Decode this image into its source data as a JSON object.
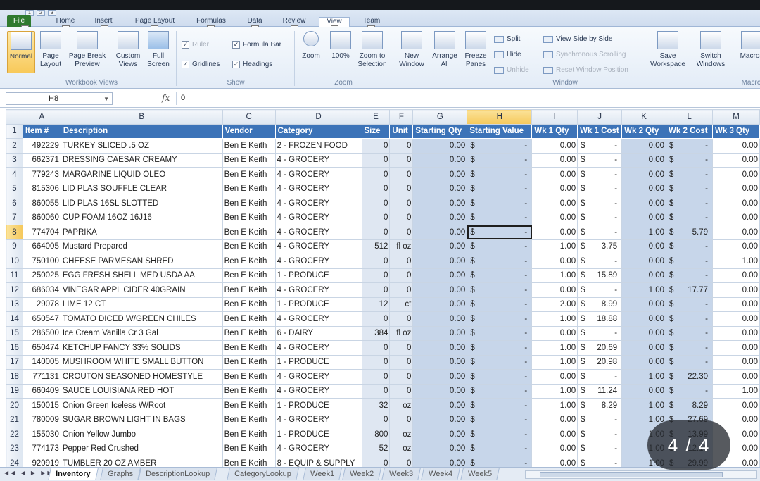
{
  "ribbon": {
    "file_tab": "File",
    "tabs": [
      "Home",
      "Insert",
      "Page Layout",
      "Formulas",
      "Data",
      "Review",
      "View",
      "Team"
    ],
    "active_tab": "View",
    "keytips": [
      "H",
      "N",
      "P",
      "M",
      "A",
      "R",
      "W",
      "Y"
    ],
    "file_keytip": "F",
    "qat_keytips": [
      "1",
      "2",
      "3"
    ],
    "workbook_views": {
      "title": "Workbook Views",
      "normal": "Normal",
      "page_layout": "Page Layout",
      "page_break_preview": "Page Break Preview",
      "custom_views": "Custom Views",
      "full_screen": "Full Screen"
    },
    "show": {
      "title": "Show",
      "ruler": "Ruler",
      "formula_bar": "Formula Bar",
      "gridlines": "Gridlines",
      "headings": "Headings"
    },
    "zoom": {
      "title": "Zoom",
      "zoom": "Zoom",
      "hundred": "100%",
      "zoom_to_selection": "Zoom to Selection"
    },
    "window": {
      "title": "Window",
      "new_window": "New Window",
      "arrange_all": "Arrange All",
      "freeze_panes": "Freeze Panes",
      "split": "Split",
      "hide": "Hide",
      "unhide": "Unhide",
      "view_side_by_side": "View Side by Side",
      "synchronous_scrolling": "Synchronous Scrolling",
      "reset_window_position": "Reset Window Position",
      "save_workspace": "Save Workspace",
      "switch_windows": "Switch Windows",
      "macros": "Macros"
    },
    "macros_group_title": "Macros"
  },
  "formula_bar": {
    "name_box": "H8",
    "fx": "fx",
    "value": "0"
  },
  "columns": [
    "A",
    "B",
    "C",
    "D",
    "E",
    "F",
    "G",
    "H",
    "I",
    "J",
    "K",
    "L",
    "M"
  ],
  "selected_column": "H",
  "selected_row": "8",
  "headers": [
    "Item #",
    "Description",
    "Vendor",
    "Category",
    "Size",
    "Unit",
    "Starting Qty",
    "Starting Value",
    "Wk 1 Qty",
    "Wk 1 Cost",
    "Wk 2 Qty",
    "Wk 2 Cost",
    "Wk 3 Qty"
  ],
  "rows": [
    {
      "r": "2",
      "item": "492229",
      "desc": "TURKEY SLICED .5 OZ",
      "vendor": "Ben E Keith",
      "cat": "2 - FROZEN FOOD",
      "size": "0",
      "unit": "0",
      "sqty": "0.00",
      "sval": "-",
      "w1q": "0.00",
      "w1c": "-",
      "w2q": "0.00",
      "w2c": "-",
      "w3q": "0.00"
    },
    {
      "r": "3",
      "item": "662371",
      "desc": "DRESSING CAESAR CREAMY",
      "vendor": "Ben E Keith",
      "cat": "4 - GROCERY",
      "size": "0",
      "unit": "0",
      "sqty": "0.00",
      "sval": "-",
      "w1q": "0.00",
      "w1c": "-",
      "w2q": "0.00",
      "w2c": "-",
      "w3q": "0.00"
    },
    {
      "r": "4",
      "item": "779243",
      "desc": "MARGARINE LIQUID OLEO",
      "vendor": "Ben E Keith",
      "cat": "4 - GROCERY",
      "size": "0",
      "unit": "0",
      "sqty": "0.00",
      "sval": "-",
      "w1q": "0.00",
      "w1c": "-",
      "w2q": "0.00",
      "w2c": "-",
      "w3q": "0.00"
    },
    {
      "r": "5",
      "item": "815306",
      "desc": "LID PLAS SOUFFLE CLEAR",
      "vendor": "Ben E Keith",
      "cat": "4 - GROCERY",
      "size": "0",
      "unit": "0",
      "sqty": "0.00",
      "sval": "-",
      "w1q": "0.00",
      "w1c": "-",
      "w2q": "0.00",
      "w2c": "-",
      "w3q": "0.00"
    },
    {
      "r": "6",
      "item": "860055",
      "desc": "LID PLAS 16SL SLOTTED",
      "vendor": "Ben E Keith",
      "cat": "4 - GROCERY",
      "size": "0",
      "unit": "0",
      "sqty": "0.00",
      "sval": "-",
      "w1q": "0.00",
      "w1c": "-",
      "w2q": "0.00",
      "w2c": "-",
      "w3q": "0.00"
    },
    {
      "r": "7",
      "item": "860060",
      "desc": "CUP FOAM 16OZ 16J16",
      "vendor": "Ben E Keith",
      "cat": "4 - GROCERY",
      "size": "0",
      "unit": "0",
      "sqty": "0.00",
      "sval": "-",
      "w1q": "0.00",
      "w1c": "-",
      "w2q": "0.00",
      "w2c": "-",
      "w3q": "0.00"
    },
    {
      "r": "8",
      "item": "774704",
      "desc": "PAPRIKA",
      "vendor": "Ben E Keith",
      "cat": "4 - GROCERY",
      "size": "0",
      "unit": "0",
      "sqty": "0.00",
      "sval": "-",
      "w1q": "0.00",
      "w1c": "-",
      "w2q": "1.00",
      "w2c": "5.79",
      "w3q": "0.00"
    },
    {
      "r": "9",
      "item": "664005",
      "desc": "Mustard Prepared",
      "vendor": "Ben E Keith",
      "cat": "4 - GROCERY",
      "size": "512",
      "unit": "fl oz",
      "sqty": "0.00",
      "sval": "-",
      "w1q": "1.00",
      "w1c": "3.75",
      "w2q": "0.00",
      "w2c": "-",
      "w3q": "0.00"
    },
    {
      "r": "10",
      "item": "750100",
      "desc": "CHEESE PARMESAN SHRED",
      "vendor": "Ben E Keith",
      "cat": "4 - GROCERY",
      "size": "0",
      "unit": "0",
      "sqty": "0.00",
      "sval": "-",
      "w1q": "0.00",
      "w1c": "-",
      "w2q": "0.00",
      "w2c": "-",
      "w3q": "1.00"
    },
    {
      "r": "11",
      "item": "250025",
      "desc": "EGG FRESH SHELL MED USDA AA",
      "vendor": "Ben E Keith",
      "cat": "1 - PRODUCE",
      "size": "0",
      "unit": "0",
      "sqty": "0.00",
      "sval": "-",
      "w1q": "1.00",
      "w1c": "15.89",
      "w2q": "0.00",
      "w2c": "-",
      "w3q": "0.00"
    },
    {
      "r": "12",
      "item": "686034",
      "desc": "VINEGAR APPL CIDER 40GRAIN",
      "vendor": "Ben E Keith",
      "cat": "4 - GROCERY",
      "size": "0",
      "unit": "0",
      "sqty": "0.00",
      "sval": "-",
      "w1q": "0.00",
      "w1c": "-",
      "w2q": "1.00",
      "w2c": "17.77",
      "w3q": "0.00"
    },
    {
      "r": "13",
      "item": "29078",
      "desc": "LIME 12 CT",
      "vendor": "Ben E Keith",
      "cat": "1 - PRODUCE",
      "size": "12",
      "unit": "ct",
      "sqty": "0.00",
      "sval": "-",
      "w1q": "2.00",
      "w1c": "8.99",
      "w2q": "0.00",
      "w2c": "-",
      "w3q": "0.00"
    },
    {
      "r": "14",
      "item": "650547",
      "desc": "TOMATO DICED W/GREEN CHILES",
      "vendor": "Ben E Keith",
      "cat": "4 - GROCERY",
      "size": "0",
      "unit": "0",
      "sqty": "0.00",
      "sval": "-",
      "w1q": "1.00",
      "w1c": "18.88",
      "w2q": "0.00",
      "w2c": "-",
      "w3q": "0.00"
    },
    {
      "r": "15",
      "item": "286500",
      "desc": "Ice Cream Vanilla Cr 3 Gal",
      "vendor": "Ben E Keith",
      "cat": "6 - DAIRY",
      "size": "384",
      "unit": "fl oz",
      "sqty": "0.00",
      "sval": "-",
      "w1q": "0.00",
      "w1c": "-",
      "w2q": "0.00",
      "w2c": "-",
      "w3q": "0.00"
    },
    {
      "r": "16",
      "item": "650474",
      "desc": "KETCHUP FANCY 33% SOLIDS",
      "vendor": "Ben E Keith",
      "cat": "4 - GROCERY",
      "size": "0",
      "unit": "0",
      "sqty": "0.00",
      "sval": "-",
      "w1q": "1.00",
      "w1c": "20.69",
      "w2q": "0.00",
      "w2c": "-",
      "w3q": "0.00"
    },
    {
      "r": "17",
      "item": "140005",
      "desc": "MUSHROOM WHITE SMALL BUTTON",
      "vendor": "Ben E Keith",
      "cat": "1 - PRODUCE",
      "size": "0",
      "unit": "0",
      "sqty": "0.00",
      "sval": "-",
      "w1q": "1.00",
      "w1c": "20.98",
      "w2q": "0.00",
      "w2c": "-",
      "w3q": "0.00"
    },
    {
      "r": "18",
      "item": "771131",
      "desc": "CROUTON SEASONED HOMESTYLE",
      "vendor": "Ben E Keith",
      "cat": "4 - GROCERY",
      "size": "0",
      "unit": "0",
      "sqty": "0.00",
      "sval": "-",
      "w1q": "0.00",
      "w1c": "-",
      "w2q": "1.00",
      "w2c": "22.30",
      "w3q": "0.00"
    },
    {
      "r": "19",
      "item": "660409",
      "desc": "SAUCE LOUISIANA RED HOT",
      "vendor": "Ben E Keith",
      "cat": "4 - GROCERY",
      "size": "0",
      "unit": "0",
      "sqty": "0.00",
      "sval": "-",
      "w1q": "1.00",
      "w1c": "11.24",
      "w2q": "0.00",
      "w2c": "-",
      "w3q": "1.00"
    },
    {
      "r": "20",
      "item": "150015",
      "desc": "Onion Green Iceless W/Root",
      "vendor": "Ben E Keith",
      "cat": "1 - PRODUCE",
      "size": "32",
      "unit": "oz",
      "sqty": "0.00",
      "sval": "-",
      "w1q": "1.00",
      "w1c": "8.29",
      "w2q": "1.00",
      "w2c": "8.29",
      "w3q": "0.00"
    },
    {
      "r": "21",
      "item": "780009",
      "desc": "SUGAR BROWN LIGHT IN BAGS",
      "vendor": "Ben E Keith",
      "cat": "4 - GROCERY",
      "size": "0",
      "unit": "0",
      "sqty": "0.00",
      "sval": "-",
      "w1q": "0.00",
      "w1c": "-",
      "w2q": "1.00",
      "w2c": "27.69",
      "w3q": "0.00"
    },
    {
      "r": "22",
      "item": "155030",
      "desc": "Onion Yellow Jumbo",
      "vendor": "Ben E Keith",
      "cat": "1 - PRODUCE",
      "size": "800",
      "unit": "oz",
      "sqty": "0.00",
      "sval": "-",
      "w1q": "0.00",
      "w1c": "-",
      "w2q": "1.00",
      "w2c": "13.99",
      "w3q": "0.00"
    },
    {
      "r": "23",
      "item": "774173",
      "desc": "Pepper Red Crushed",
      "vendor": "Ben E Keith",
      "cat": "4 - GROCERY",
      "size": "52",
      "unit": "oz",
      "sqty": "0.00",
      "sval": "-",
      "w1q": "0.00",
      "w1c": "-",
      "w2q": "1.00",
      "w2c": "12.18",
      "w3q": "0.00"
    },
    {
      "r": "24",
      "item": "920919",
      "desc": "TUMBLER 20 OZ AMBER",
      "vendor": "Ben E Keith",
      "cat": "8 - EQUIP & SUPPLY",
      "size": "0",
      "unit": "0",
      "sqty": "0.00",
      "sval": "-",
      "w1q": "0.00",
      "w1c": "-",
      "w2q": "1.00",
      "w2c": "29.99",
      "w3q": "0.00"
    }
  ],
  "currency_symbol": "$",
  "sheet_tabs": [
    "Inventory",
    "Graphs",
    "DescriptionLookup",
    "CategoryLookup",
    "Week1",
    "Week2",
    "Week3",
    "Week4",
    "Week5"
  ],
  "active_sheet": "Inventory",
  "pager": "4 / 4"
}
